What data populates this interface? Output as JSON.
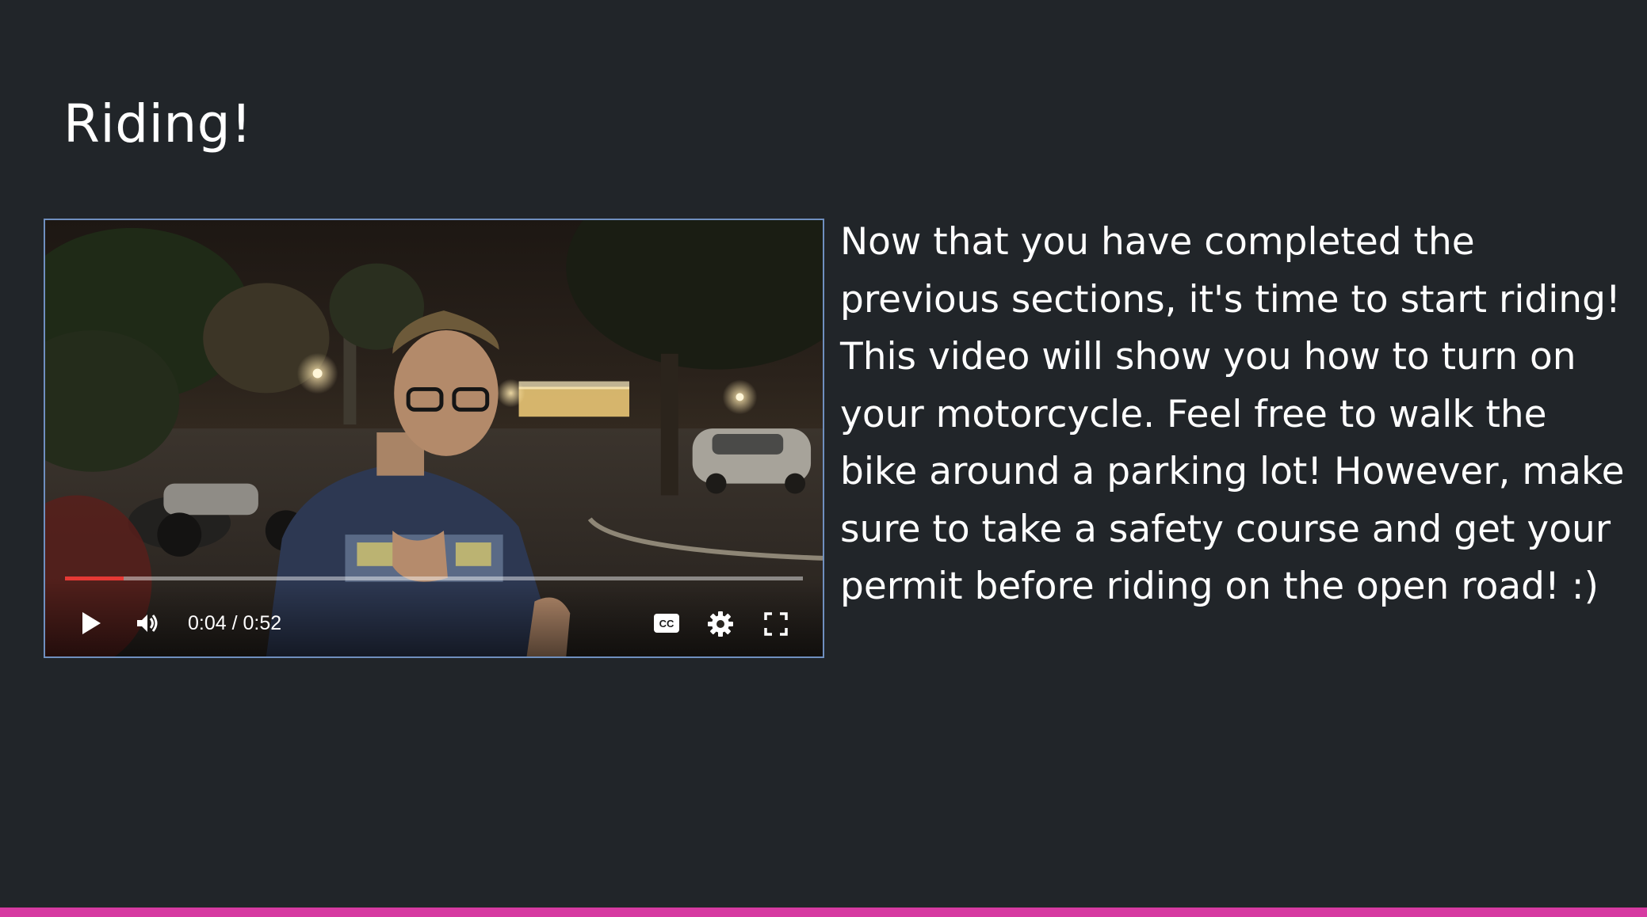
{
  "slide": {
    "title": "Riding!",
    "body": "Now that you have completed the previous sections, it's time to start riding! This video will show you how to turn on your motorcycle. Feel free to walk the bike around a parking lot! However, make sure to take a safety course and get your permit before riding on the open road! :)"
  },
  "video": {
    "time_display": "0:04 / 0:52",
    "progress_fraction": 0.08,
    "controls": {
      "play_icon": "play-icon",
      "volume_icon": "volume-icon",
      "cc_icon": "closed-captions-icon",
      "settings_icon": "gear-icon",
      "fullscreen_icon": "fullscreen-icon"
    }
  },
  "colors": {
    "background": "#212529",
    "text": "#ffffff",
    "video_border": "#6f8fbf",
    "progress": "#e53935",
    "footer_accent": "#d63aa1"
  }
}
